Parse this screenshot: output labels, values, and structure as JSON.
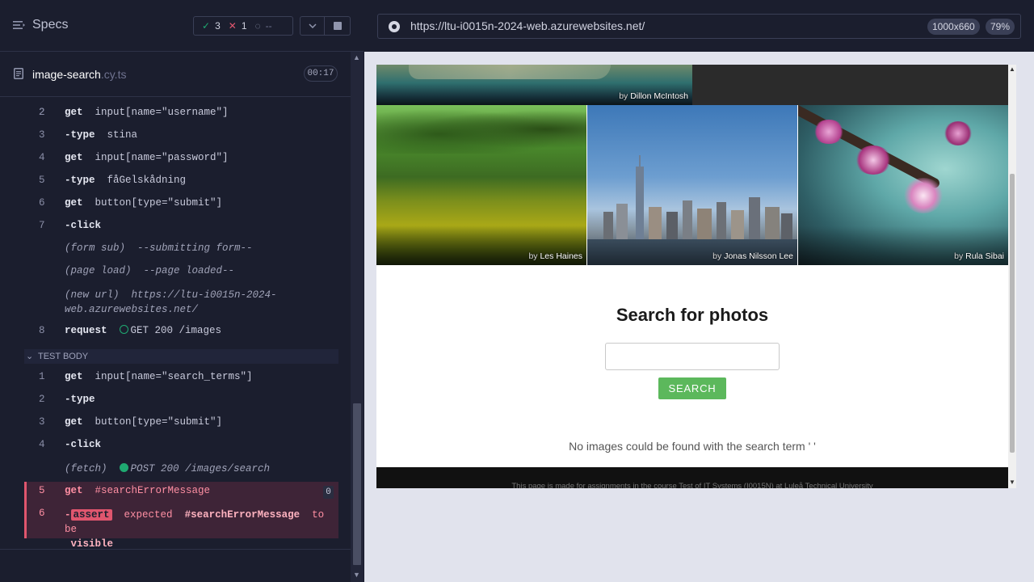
{
  "reporter": {
    "specs_label": "Specs",
    "stats": {
      "passed": "3",
      "failed": "1",
      "pending": "--"
    },
    "spec_file": {
      "name": "image-search",
      "ext": ".cy.ts",
      "duration": "00:17"
    },
    "before_commands": [
      {
        "num": "2",
        "cmd": "get",
        "arg": "input[name=\"username\"]"
      },
      {
        "num": "3",
        "cmd": "-type",
        "arg": "stina"
      },
      {
        "num": "4",
        "cmd": "get",
        "arg": "input[name=\"password\"]"
      },
      {
        "num": "5",
        "cmd": "-type",
        "arg": "fåGelskådning"
      },
      {
        "num": "6",
        "cmd": "get",
        "arg": "button[type=\"submit\"]"
      },
      {
        "num": "7",
        "cmd": "-click",
        "arg": ""
      }
    ],
    "events": [
      {
        "name": "(form sub)",
        "text": "--submitting form--"
      },
      {
        "name": "(page load)",
        "text": "--page loaded--"
      },
      {
        "name": "(new url)",
        "text_line1": "https://ltu-i0015n-2024-",
        "text_line2": "web.azurewebsites.net/"
      }
    ],
    "request_row": {
      "num": "8",
      "cmd": "request",
      "arg": "GET 200 /images"
    },
    "test_body_label": "TEST BODY",
    "body_commands": [
      {
        "num": "1",
        "cmd": "get",
        "arg": "input[name=\"search_terms\"]"
      },
      {
        "num": "2",
        "cmd": "-type",
        "arg": ""
      },
      {
        "num": "3",
        "cmd": "get",
        "arg": "button[type=\"submit\"]"
      },
      {
        "num": "4",
        "cmd": "-click",
        "arg": ""
      }
    ],
    "fetch_row": {
      "name": "(fetch)",
      "text": "POST 200 /images/search"
    },
    "failed_get": {
      "num": "5",
      "cmd": "get",
      "arg": "#searchErrorMessage",
      "badge": "0"
    },
    "failed_assert": {
      "num": "6",
      "tag": "assert",
      "word_expected": "expected",
      "selector": "#searchErrorMessage",
      "to_be": "to be",
      "line2": "visible"
    }
  },
  "browser": {
    "url": "https://ltu-i0015n-2024-web.azurewebsites.net/",
    "viewport": "1000x660",
    "zoom": "79%"
  },
  "app": {
    "photos": [
      {
        "by": "by",
        "author": "Dillon McIntosh"
      },
      {
        "by": "by",
        "author": "Les Haines"
      },
      {
        "by": "by",
        "author": "Jonas Nilsson Lee"
      },
      {
        "by": "by",
        "author": "Rula Sibai"
      }
    ],
    "search_title": "Search for photos",
    "search_input_value": "",
    "search_button": "SEARCH",
    "error_message": "No images could be found with the search term ' '",
    "footer_text": "This page is made for assignments in the course Test of IT Systems (I0015N) at Luleå Technical University"
  },
  "colors": {
    "passed": "#1fa971",
    "failed": "#e0566e",
    "search_button": "#5cb85c"
  }
}
